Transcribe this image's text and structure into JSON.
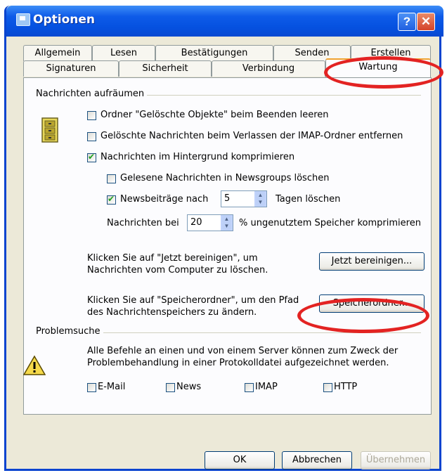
{
  "window": {
    "title": "Optionen"
  },
  "title_buttons": {
    "help": "?",
    "close": "✕"
  },
  "tabs_row1": [
    "Allgemein",
    "Lesen",
    "Bestätigungen",
    "Senden",
    "Erstellen"
  ],
  "tabs_row2": [
    "Signaturen",
    "Sicherheit",
    "Verbindung",
    "Wartung"
  ],
  "active_tab": "Wartung",
  "cleanup": {
    "group_label": "Nachrichten aufräumen",
    "options": [
      {
        "label": "Ordner \"Gelöschte Objekte\" beim Beenden leeren",
        "checked": false
      },
      {
        "label": "Gelöschte Nachrichten beim Verlassen der IMAP-Ordner entfernen",
        "checked": false
      },
      {
        "label": "Nachrichten im Hintergrund komprimieren",
        "checked": true
      },
      {
        "label": "Gelesene Nachrichten in Newsgroups löschen",
        "checked": false
      },
      {
        "label": "Newsbeiträge nach",
        "checked": true
      }
    ],
    "news_days_value": "5",
    "news_days_suffix": "Tagen löschen",
    "compress_prefix": "Nachrichten bei",
    "compress_value": "20",
    "compress_suffix": "% ungenutztem Speicher komprimieren",
    "clean_text_line1": "Klicken Sie auf \"Jetzt bereinigen\", um",
    "clean_text_line2": "Nachrichten vom Computer zu löschen.",
    "clean_button": "Jetzt bereinigen...",
    "store_text_line1": "Klicken Sie auf \"Speicherordner\", um den Pfad",
    "store_text_line2": "des Nachrichtenspeichers zu ändern.",
    "store_button": "Speicherordner..."
  },
  "troubleshooting": {
    "group_label": "Problemsuche",
    "text_line1": "Alle Befehle an einen und von einem Server können zum Zweck der",
    "text_line2": "Problembehandlung in einer Protokolldatei aufgezeichnet werden.",
    "checks": [
      {
        "label": "E-Mail",
        "checked": false
      },
      {
        "label": "News",
        "checked": false
      },
      {
        "label": "IMAP",
        "checked": false
      },
      {
        "label": "HTTP",
        "checked": false
      }
    ]
  },
  "footer": {
    "ok": "OK",
    "cancel": "Abbrechen",
    "apply": "Übernehmen"
  },
  "colors": {
    "title_bar": "#0551e0",
    "annotation": "#e32322",
    "active_tab_top": "#f0a22e"
  }
}
